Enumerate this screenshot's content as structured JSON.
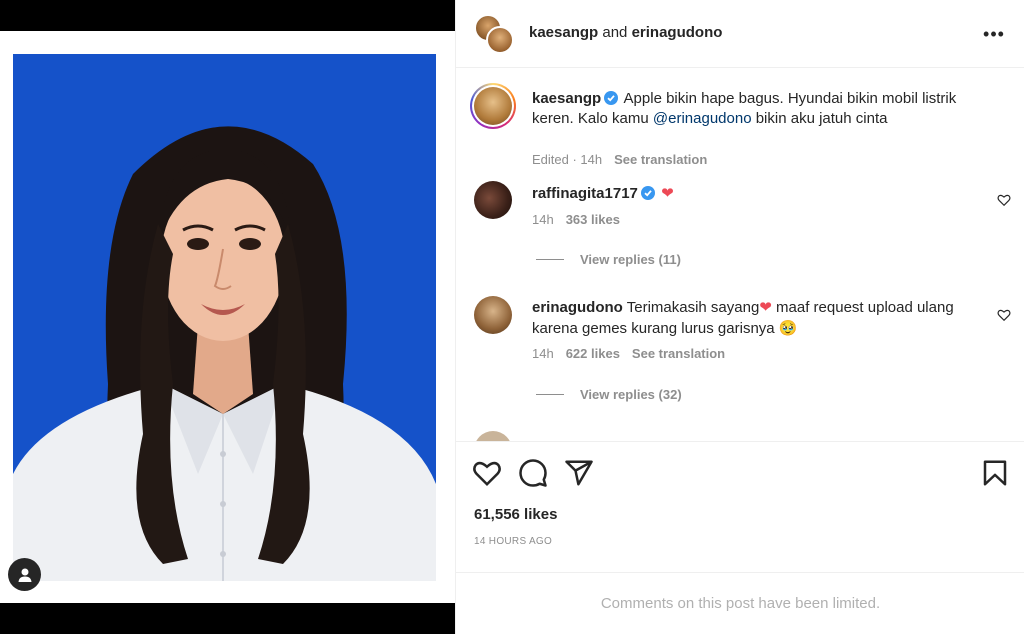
{
  "header": {
    "owner": "kaesangp",
    "connector": " and ",
    "collaborator": "erinagudono",
    "more_label": "•••"
  },
  "caption": {
    "username": "kaesangp",
    "text_before_mention": "Apple bikin hape bagus. Hyundai bikin mobil listrik keren. Kalo kamu ",
    "mention": "@erinagudono",
    "text_after_mention": " bikin aku jatuh cinta",
    "edited": "Edited · 14h",
    "translate": "See translation"
  },
  "comments": [
    {
      "username": "raffinagita1717",
      "text": "",
      "emoji": "❤",
      "time": "14h",
      "likes": "363 likes",
      "replies": "View replies (11)"
    },
    {
      "username": "erinagudono",
      "text": "Terimakasih sayang",
      "emoji": "❤",
      "text2": " maaf request upload ulang karena gemes kurang lurus garisnya ",
      "emoji2": "🥹",
      "time": "14h",
      "likes": "622 likes",
      "translate": "See translation",
      "replies": "View replies (32)"
    }
  ],
  "actions": {
    "likes": "61,556 likes",
    "time_ago": "14 HOURS AGO"
  },
  "footer": {
    "limited": "Comments on this post have been limited."
  },
  "colors": {
    "photo_background": "#1552c9",
    "verified": "#3897f0",
    "heart": "#ed4956",
    "mention": "#00376b"
  }
}
